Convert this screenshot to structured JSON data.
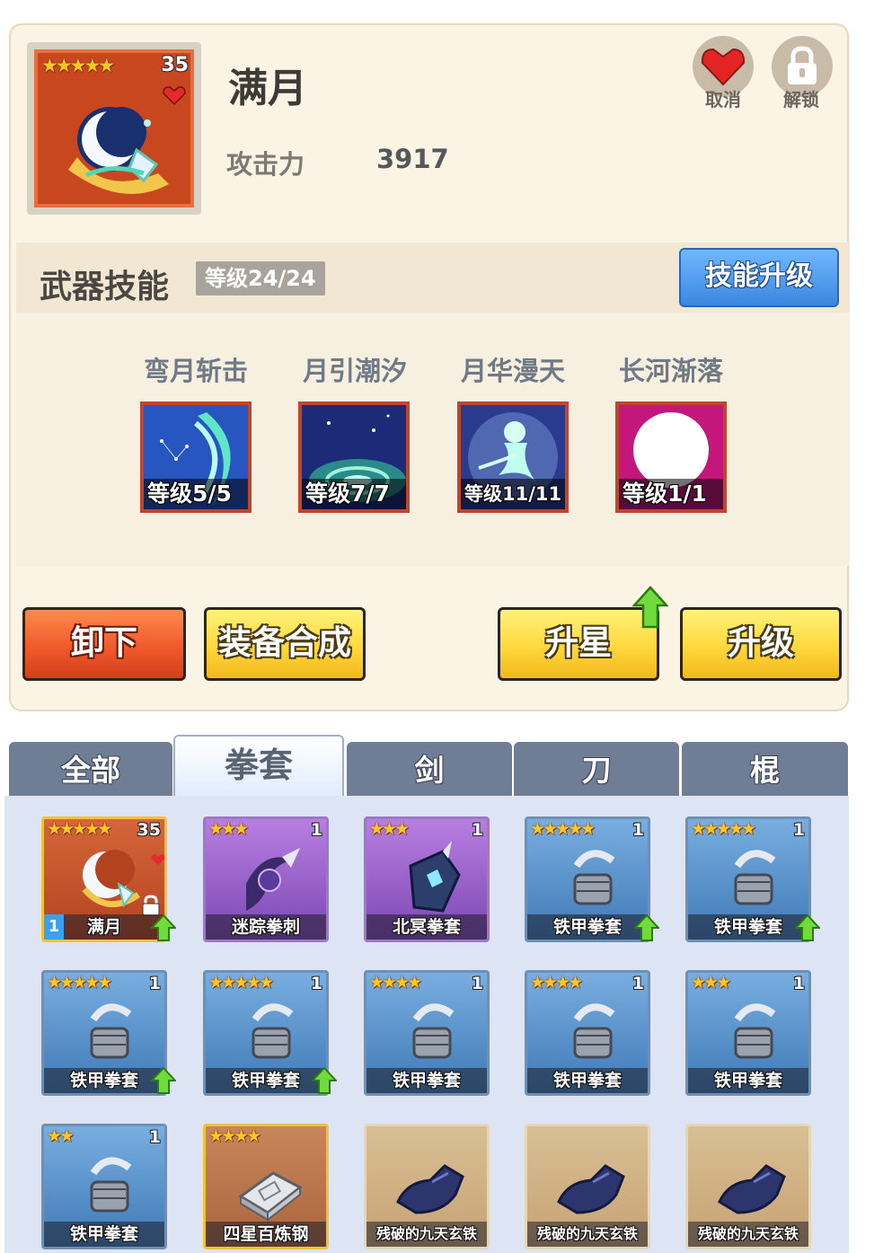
{
  "weapon": {
    "name": "满月",
    "stars": "★★★★★",
    "level": "35",
    "attack_label": "攻击力",
    "attack_value": "3917"
  },
  "header_actions": {
    "cancel_label": "取消",
    "unlock_label": "解锁"
  },
  "skills_section": {
    "title": "武器技能",
    "level_tag": "等级24/24",
    "upgrade_label": "技能升级",
    "skills": [
      {
        "name": "弯月斩击",
        "level": "等级5/5"
      },
      {
        "name": "月引潮汐",
        "level": "等级7/7"
      },
      {
        "name": "月华漫天",
        "level": "等级11/11"
      },
      {
        "name": "长河渐落",
        "level": "等级1/1"
      }
    ]
  },
  "actions": {
    "unequip": "卸下",
    "synthesize": "装备合成",
    "star_up": "升星",
    "level_up": "升级"
  },
  "tabs": [
    "全部",
    "拳套",
    "剑",
    "刀",
    "棍"
  ],
  "active_tab": "拳套",
  "inventory": [
    {
      "name": "满月",
      "stars": "★★★★★",
      "count": "35",
      "rarity": "orange",
      "upgrade": true,
      "locked": true,
      "equipped_badge": "1"
    },
    {
      "name": "迷踪拳刺",
      "stars": "★★★",
      "count": "1",
      "rarity": "purple",
      "upgrade": false
    },
    {
      "name": "北冥拳套",
      "stars": "★★★",
      "count": "1",
      "rarity": "purple",
      "upgrade": false
    },
    {
      "name": "铁甲拳套",
      "stars": "★★★★★",
      "count": "1",
      "rarity": "blue",
      "upgrade": true
    },
    {
      "name": "铁甲拳套",
      "stars": "★★★★★",
      "count": "1",
      "rarity": "blue",
      "upgrade": true
    },
    {
      "name": "铁甲拳套",
      "stars": "★★★★★",
      "count": "1",
      "rarity": "blue",
      "upgrade": true
    },
    {
      "name": "铁甲拳套",
      "stars": "★★★★★",
      "count": "1",
      "rarity": "blue",
      "upgrade": true
    },
    {
      "name": "铁甲拳套",
      "stars": "★★★★",
      "count": "1",
      "rarity": "blue",
      "upgrade": false
    },
    {
      "name": "铁甲拳套",
      "stars": "★★★★",
      "count": "1",
      "rarity": "blue",
      "upgrade": false
    },
    {
      "name": "铁甲拳套",
      "stars": "★★★",
      "count": "1",
      "rarity": "blue",
      "upgrade": false
    },
    {
      "name": "铁甲拳套",
      "stars": "★★",
      "count": "1",
      "rarity": "blue",
      "upgrade": false
    },
    {
      "name": "四星百炼钢",
      "stars": "★★★★",
      "count": "",
      "rarity": "brown",
      "upgrade": false
    },
    {
      "name": "残破的九天玄铁",
      "stars": "",
      "count": "",
      "rarity": "tan",
      "upgrade": false
    },
    {
      "name": "残破的九天玄铁",
      "stars": "",
      "count": "",
      "rarity": "tan",
      "upgrade": false
    },
    {
      "name": "残破的九天玄铁",
      "stars": "",
      "count": "",
      "rarity": "tan",
      "upgrade": false
    }
  ],
  "colors": {
    "panel_bg": "#fbf4e4",
    "tab_bg": "#6f7d95",
    "skill_upgrade_blue": "#3b87e0",
    "unequip_red": "#f05a2c",
    "yellow_button": "#ffd83c",
    "upgrade_arrow_green": "#5fd13a"
  }
}
